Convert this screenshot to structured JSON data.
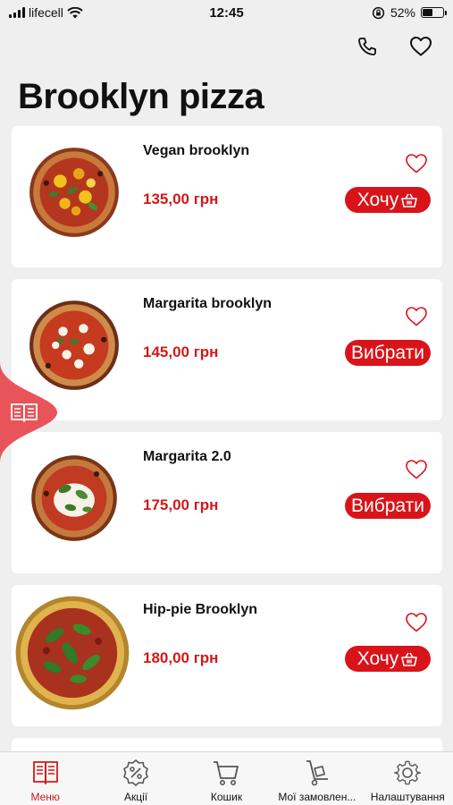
{
  "status": {
    "carrier": "lifecell",
    "time": "12:45",
    "battery": "52%",
    "battery_level": 0.52
  },
  "page": {
    "title": "Brooklyn pizza"
  },
  "colors": {
    "accent": "#d8141a",
    "price": "#d11a1a",
    "background": "#efefef"
  },
  "items": [
    {
      "name": "Vegan brooklyn",
      "price": "135,00 грн",
      "button": "Хочу",
      "button_icon": "basket-icon",
      "favorite": false
    },
    {
      "name": "Margarita brooklyn",
      "price": "145,00 грн",
      "button": "Вибрати",
      "button_icon": "",
      "favorite": false
    },
    {
      "name": "Margarita 2.0",
      "price": "175,00 грн",
      "button": "Вибрати",
      "button_icon": "",
      "favorite": false
    },
    {
      "name": "Hip-pie Brooklyn",
      "price": "180,00 грн",
      "button": "Хочу",
      "button_icon": "basket-icon",
      "favorite": false
    }
  ],
  "tabs": [
    {
      "label": "Меню",
      "icon": "menu-book-icon",
      "active": true
    },
    {
      "label": "Акції",
      "icon": "percent-badge-icon",
      "active": false
    },
    {
      "label": "Кошик",
      "icon": "cart-icon",
      "active": false
    },
    {
      "label": "Мої замовлен...",
      "icon": "hand-truck-icon",
      "active": false
    },
    {
      "label": "Налаштування",
      "icon": "gear-icon",
      "active": false
    }
  ]
}
